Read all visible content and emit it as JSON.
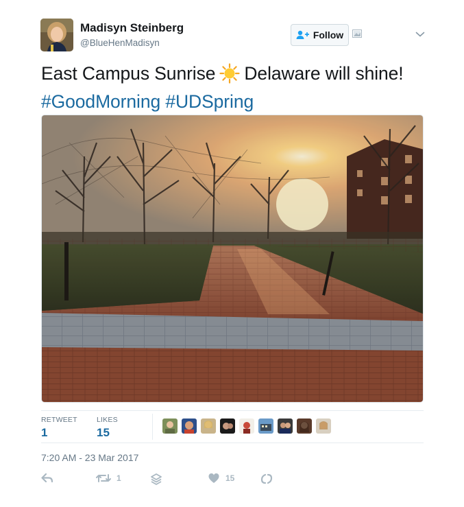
{
  "user": {
    "name": "Madisyn Steinberg",
    "handle": "@BlueHenMadisyn",
    "avatar_icon": "profile-photo"
  },
  "follow": {
    "label": "Follow",
    "icon": "add-user-icon"
  },
  "tweet": {
    "text_before_emoji": "East Campus Sunrise",
    "emoji": "sun-emoji",
    "text_after_emoji": "Delaware will shine!",
    "hashtags": [
      "#GoodMorning",
      "#UDSpring"
    ]
  },
  "stats": {
    "retweets_label": "RETWEET",
    "retweets_count": "1",
    "likes_label": "LIKES",
    "likes_count": "15",
    "liker_avatars": 9
  },
  "timestamp": "7:20 AM - 23 Mar 2017",
  "actions": {
    "reply_icon": "reply-icon",
    "retweet_count": "1",
    "like_count": "15"
  },
  "colors": {
    "link": "#1b6aa0",
    "muted": "#657786",
    "icon": "#aab8c2"
  }
}
